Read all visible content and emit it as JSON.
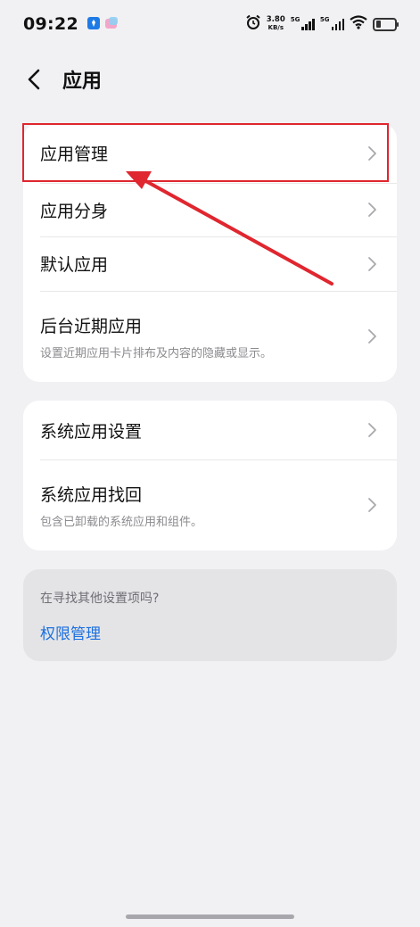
{
  "status_bar": {
    "time": "09:22",
    "net_speed_value": "3.80",
    "net_speed_unit": "KB/s",
    "sim1_label": "5G",
    "sim2_label": "5G",
    "battery_level": 0.28,
    "icons": [
      "app-notification-icon",
      "app-notification-icon-2",
      "alarm-icon",
      "signal-icon",
      "signal-icon",
      "wifi-icon",
      "battery-icon"
    ]
  },
  "header": {
    "title": "应用",
    "back_icon": "chevron-left-icon"
  },
  "group1": {
    "items": [
      {
        "title": "应用管理",
        "subtitle": ""
      },
      {
        "title": "应用分身",
        "subtitle": ""
      },
      {
        "title": "默认应用",
        "subtitle": ""
      },
      {
        "title": "后台近期应用",
        "subtitle": "设置近期应用卡片排布及内容的隐藏或显示。"
      }
    ]
  },
  "group2": {
    "items": [
      {
        "title": "系统应用设置",
        "subtitle": ""
      },
      {
        "title": "系统应用找回",
        "subtitle": "包含已卸载的系统应用和组件。"
      }
    ]
  },
  "suggest": {
    "hint": "在寻找其他设置项吗?",
    "link": "权限管理"
  },
  "colors": {
    "background": "#f1f1f4",
    "card": "#ffffff",
    "link": "#1a6fe0",
    "annotation": "#e0262f"
  }
}
